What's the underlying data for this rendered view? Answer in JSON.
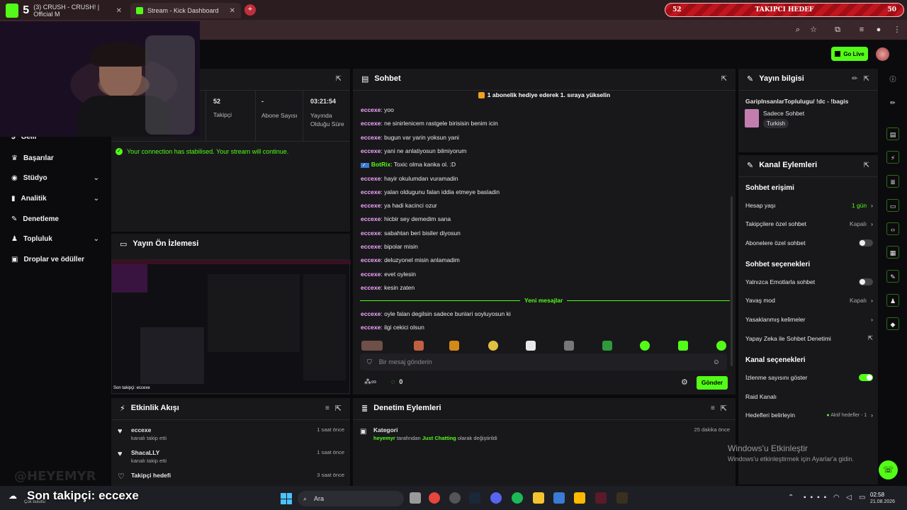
{
  "browser": {
    "tabs": [
      {
        "title": "(3) CRUSH - CRUSH! | Official M"
      },
      {
        "title": "Stream - Kick Dashboard"
      }
    ],
    "new_tab_label": "+"
  },
  "goal_overlay": {
    "left": "52",
    "title": "TAKIPCI HEDEF",
    "right": "50"
  },
  "header": {
    "go_live": "Go Live"
  },
  "sidebar": {
    "items": [
      {
        "label": "Gelir",
        "has_children": false
      },
      {
        "label": "Başarılar",
        "has_children": false
      },
      {
        "label": "Stüdyo",
        "has_children": true
      },
      {
        "label": "Analitik",
        "has_children": true
      },
      {
        "label": "Denetleme",
        "has_children": false
      },
      {
        "label": "Topluluk",
        "has_children": true
      },
      {
        "label": "Droplar ve ödüller",
        "has_children": false
      }
    ]
  },
  "stats": {
    "title_partial": "i",
    "items": [
      {
        "value": "52",
        "label": "Takipçi"
      },
      {
        "value": "-",
        "label": "Abone Sayısı"
      },
      {
        "value": "03:21:54",
        "label": "Yayında Olduğu Süre"
      }
    ],
    "connection_msg": "Your connection has stabilised. Your stream will continue."
  },
  "preview": {
    "title": "Yayın Ön İzlemesi",
    "caption": "Son takipçi: eccexe"
  },
  "chat": {
    "title": "Sohbet",
    "pinned": "1 abonelik hediye ederek 1. sıraya yükselin",
    "messages": [
      {
        "user": "eccexe",
        "text": "yoo"
      },
      {
        "user": "eccexe",
        "text": "ne sinirlenicem rastgele birisisin benim icin"
      },
      {
        "user": "eccexe",
        "text": "bugun var yarin yoksun yani"
      },
      {
        "user": "eccexe",
        "text": "yani ne anlatiyosun bilmiyorum"
      },
      {
        "user": "BotRix",
        "text": "Toxic olma kanka ol. :D",
        "bot": true
      },
      {
        "user": "eccexe",
        "text": "hayir okulumdan vuramadin"
      },
      {
        "user": "eccexe",
        "text": "yalan oldugunu falan iddia etmeye basladin"
      },
      {
        "user": "eccexe",
        "text": "ya hadi kacinci ozur"
      },
      {
        "user": "eccexe",
        "text": "hicbir sey demedim sana"
      },
      {
        "user": "eccexe",
        "text": "sabahtan beri bisiler diyosun"
      },
      {
        "user": "eccexe",
        "text": "bipolar misin"
      },
      {
        "user": "eccexe",
        "text": "deluzyonel misin anlamadim"
      },
      {
        "user": "eccexe",
        "text": "evet oylesin"
      },
      {
        "user": "eccexe",
        "text": "kesin zaten"
      }
    ],
    "new_messages_label": "Yeni mesajlar",
    "new_messages": [
      {
        "user": "eccexe",
        "text": "oyle falan degilsin sadece bunlari soyluyosun ki"
      },
      {
        "user": "eccexe",
        "text": "ilgi cekici olsun"
      }
    ],
    "input_placeholder": "Bir mesaj gönderin",
    "points": "0",
    "send_label": "Gönder"
  },
  "stream_info": {
    "title": "Yayın bilgisi",
    "stream_title": "GaripInsanlarToplulugu/ !dc - !bagis",
    "category": "Sadece Sohbet",
    "tag": "Turkish"
  },
  "channel_actions": {
    "title": "Kanal Eylemleri",
    "chat_access_title": "Sohbet erişimi",
    "rows_access": [
      {
        "label": "Hesap yaşı",
        "value": "1 gün"
      },
      {
        "label": "Takipçilere özel sohbet",
        "value": "Kapalı"
      },
      {
        "label": "Abonelere özel sohbet",
        "value": ""
      }
    ],
    "chat_options_title": "Sohbet seçenekleri",
    "rows_options": [
      {
        "label": "Yalnızca Emotlarla sohbet",
        "value": ""
      },
      {
        "label": "Yavaş mod",
        "value": "Kapalı"
      },
      {
        "label": "Yasaklanmış kelimeler",
        "value": ""
      },
      {
        "label": "Yapay Zeka ile Sohbet Denetimi",
        "value": ""
      }
    ],
    "channel_options_title": "Kanal seçenekleri",
    "rows_channel": [
      {
        "label": "İzlenme sayısını göster",
        "value": ""
      },
      {
        "label": "Raid Kanalı",
        "value": ""
      },
      {
        "label": "Hedefleri belirleyin",
        "value": "Aktif hedefler - 1"
      }
    ]
  },
  "activity": {
    "title": "Etkinlik Akışı",
    "items": [
      {
        "name": "eccexe",
        "desc": "kanalı takip etti",
        "time": "1 saat önce"
      },
      {
        "name": "ShacaLLY",
        "desc": "kanalı takip etti",
        "time": "1 saat önce"
      },
      {
        "name": "Takipçi hedefi",
        "desc": "",
        "time": "3 saat önce"
      }
    ]
  },
  "moderation": {
    "title": "Denetim Eylemleri",
    "item_title": "Kategori",
    "item_user": "heyemyr",
    "item_mid": "tarafından",
    "item_category": "Just Chatting",
    "item_end": "olarak değiştirildi",
    "time": "25 dakika önce"
  },
  "watermark": {
    "line1": "Windows'u Etkinleştir",
    "line2": "Windows'u etkinleştirmek için Ayarlar'a gidin."
  },
  "overlay_caption": "Son takipçi: eccexe",
  "overlay_handle": "@HEYEMYR",
  "taskbar": {
    "search": "Ara",
    "time": "02:58",
    "date": "21.08.2026",
    "weather": "Çok bulutlu"
  },
  "colors": {
    "accent": "#53fc18",
    "panel": "#18181b",
    "bg": "#0b0b0d",
    "username": "#f7a7ff"
  }
}
